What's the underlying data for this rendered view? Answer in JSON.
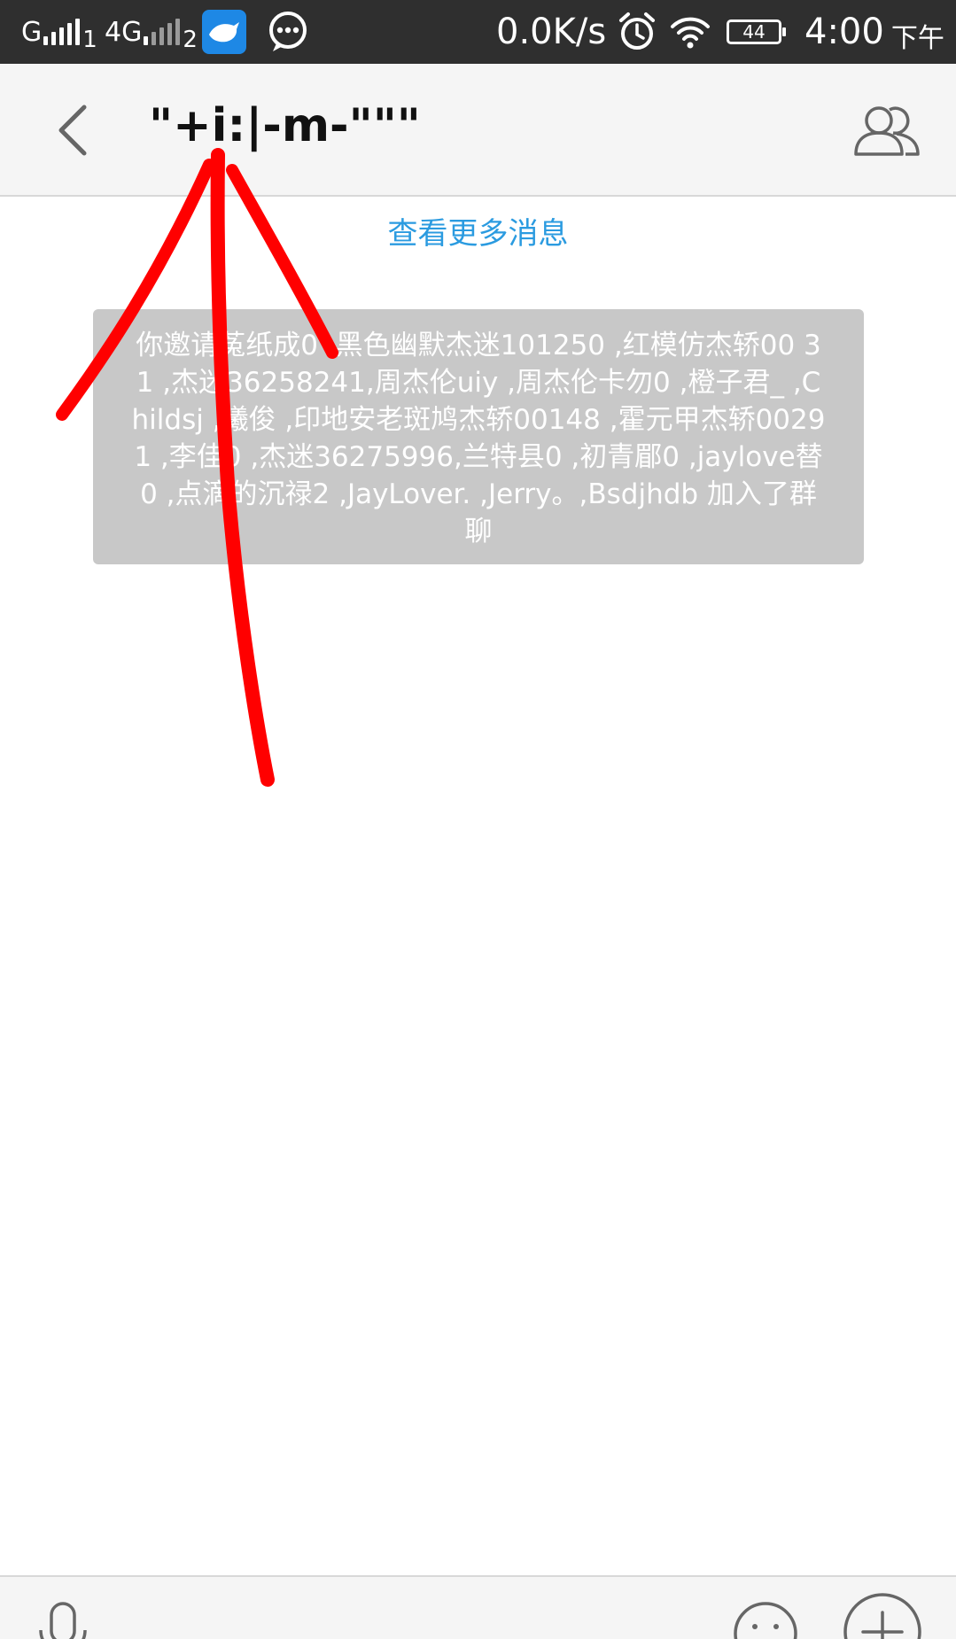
{
  "status_bar": {
    "sim1_label": "G",
    "sim1_index": "1",
    "sim2_label": "4G",
    "sim2_index": "2",
    "network_speed": "0.0K/s",
    "battery_level": "44",
    "time": "4:00",
    "am_pm": "下午",
    "icons": [
      "signal-icon",
      "bird-app-icon",
      "chat-bubble-icon",
      "alarm-icon",
      "wifi-icon",
      "battery-icon"
    ]
  },
  "header": {
    "title": "\"+i:|-m-\"\"\"",
    "icons": [
      "back-arrow-icon",
      "group-members-icon"
    ]
  },
  "chat": {
    "load_more": "查看更多消息",
    "system_notice": "你邀请菟纸成0 ,黑色幽默杰迷101250 ,红模仿杰轿00 31 ,杰迷36258241,周杰伦uiy ,周杰伦卡勿0 ,橙子君_ ,Childsj ,曦俊 ,印地安老斑鸠杰轿00148 ,霍元甲杰轿00291 ,李佳0 ,杰迷36275996,兰特县0 ,初青郿0 ,jaylove替0 ,点滴的沉禄2 ,JayLover. ,Jerry。,Bsdjhdb 加入了群聊"
  },
  "input_bar": {
    "icons": [
      "voice-icon",
      "emoji-icon",
      "plus-icon"
    ]
  },
  "colors": {
    "status_bar_bg": "#2f2f2f",
    "header_bg": "#f5f5f5",
    "link_blue": "#2b9be0",
    "notice_bg": "#c8c8c8",
    "annotation_red": "#ff0000"
  }
}
